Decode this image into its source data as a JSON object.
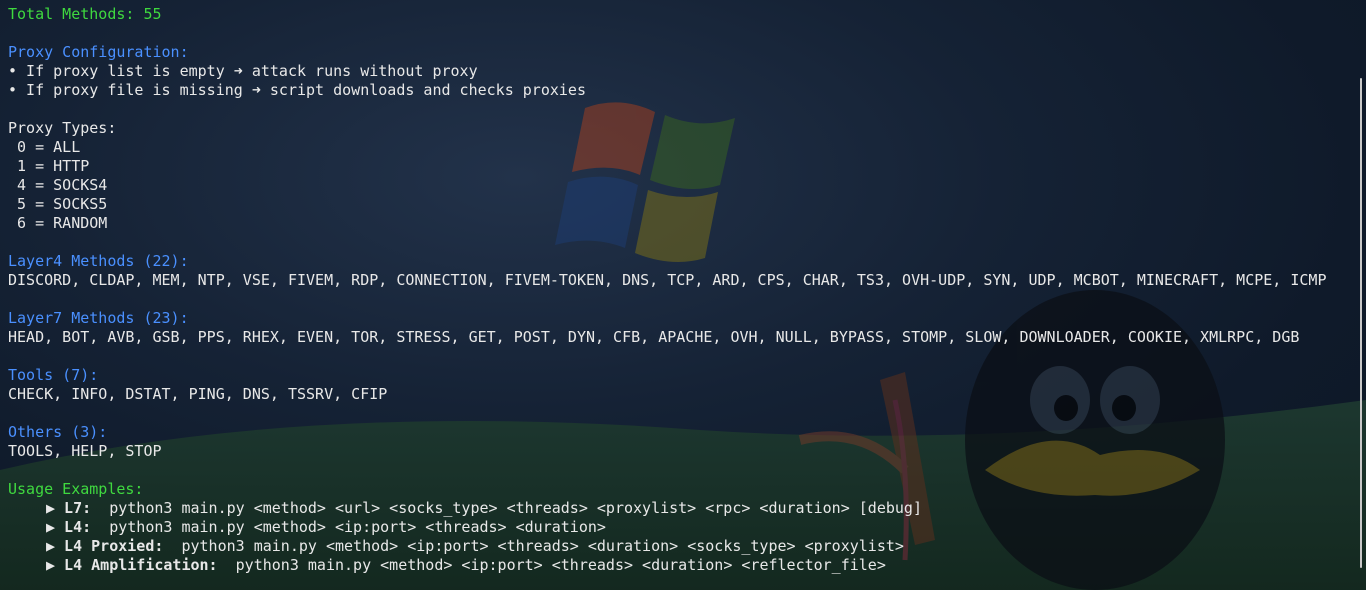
{
  "header": {
    "total_methods": "Total Methods: 55"
  },
  "proxy_config": {
    "title": "Proxy Configuration:",
    "notes": [
      "• If proxy list is empty ➜ attack runs without proxy",
      "• If proxy file is missing ➜ script downloads and checks proxies"
    ]
  },
  "proxy_types": {
    "title": "Proxy Types:",
    "items": [
      " 0 = ALL",
      " 1 = HTTP",
      " 4 = SOCKS4",
      " 5 = SOCKS5",
      " 6 = RANDOM"
    ]
  },
  "layer4": {
    "title": "Layer4 Methods (22):",
    "methods": "DISCORD, CLDAP, MEM, NTP, VSE, FIVEM, RDP, CONNECTION, FIVEM-TOKEN, DNS, TCP, ARD, CPS, CHAR, TS3, OVH-UDP, SYN, UDP, MCBOT, MINECRAFT, MCPE, ICMP"
  },
  "layer7": {
    "title": "Layer7 Methods (23):",
    "methods": "HEAD, BOT, AVB, GSB, PPS, RHEX, EVEN, TOR, STRESS, GET, POST, DYN, CFB, APACHE, OVH, NULL, BYPASS, STOMP, SLOW, DOWNLOADER, COOKIE, XMLRPC, DGB"
  },
  "tools": {
    "title": "Tools (7):",
    "methods": "CHECK, INFO, DSTAT, PING, DNS, TSSRV, CFIP"
  },
  "others": {
    "title": "Others (3):",
    "methods": "TOOLS, HELP, STOP"
  },
  "usage": {
    "title": "Usage Examples:",
    "examples": [
      {
        "label": "▶ L7:",
        "cmd": "  python3 main.py <method> <url> <socks_type> <threads> <proxylist> <rpc> <duration> [debug]"
      },
      {
        "label": "▶ L4:",
        "cmd": "  python3 main.py <method> <ip:port> <threads> <duration>"
      },
      {
        "label": "▶ L4 Proxied:",
        "cmd": "  python3 main.py <method> <ip:port> <threads> <duration> <socks_type> <proxylist>"
      },
      {
        "label": "▶ L4 Amplification:",
        "cmd": "  python3 main.py <method> <ip:port> <threads> <duration> <reflector_file>"
      }
    ]
  },
  "colors": {
    "heading_green": "#3fd93f",
    "heading_blue": "#4a90ff",
    "text": "#e8e8e8"
  }
}
